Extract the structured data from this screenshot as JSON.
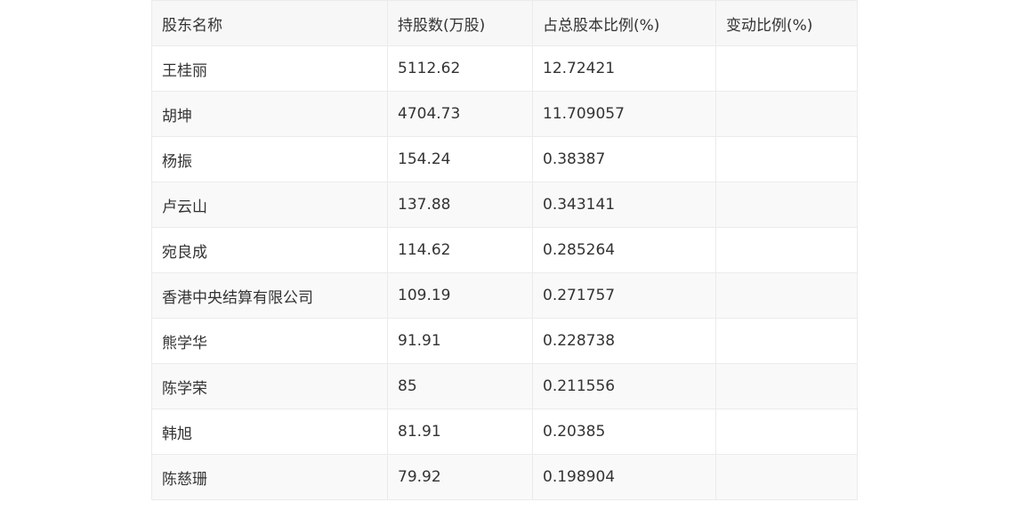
{
  "table": {
    "headers": [
      "股东名称",
      "持股数(万股)",
      "占总股本比例(%)",
      "变动比例(%)"
    ],
    "rows": [
      [
        "王桂丽",
        "5112.62",
        "12.72421",
        ""
      ],
      [
        "胡坤",
        "4704.73",
        "11.709057",
        ""
      ],
      [
        "杨振",
        "154.24",
        "0.38387",
        ""
      ],
      [
        "卢云山",
        "137.88",
        "0.343141",
        ""
      ],
      [
        "宛良成",
        "114.62",
        "0.285264",
        ""
      ],
      [
        "香港中央结算有限公司",
        "109.19",
        "0.271757",
        ""
      ],
      [
        "熊学华",
        "91.91",
        "0.228738",
        ""
      ],
      [
        "陈学荣",
        "85",
        "0.211556",
        ""
      ],
      [
        "韩旭",
        "81.91",
        "0.20385",
        ""
      ],
      [
        "陈慈珊",
        "79.92",
        "0.198904",
        ""
      ]
    ]
  }
}
